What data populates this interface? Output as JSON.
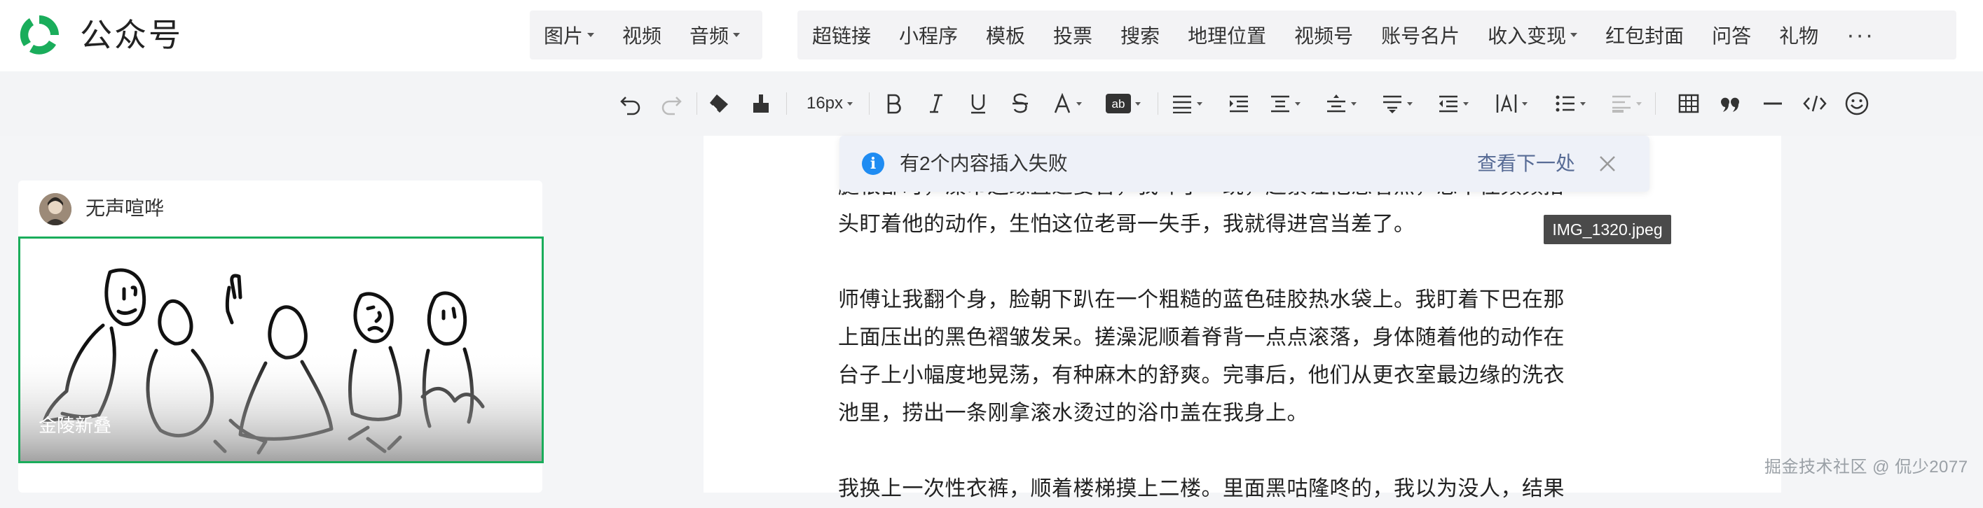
{
  "brand": {
    "name": "公众号"
  },
  "insert_menu": {
    "group1": [
      {
        "label": "图片",
        "dropdown": true
      },
      {
        "label": "视频",
        "dropdown": false
      },
      {
        "label": "音频",
        "dropdown": true
      }
    ],
    "group2": [
      {
        "label": "超链接",
        "dropdown": false
      },
      {
        "label": "小程序",
        "dropdown": false
      },
      {
        "label": "模板",
        "dropdown": false
      },
      {
        "label": "投票",
        "dropdown": false
      },
      {
        "label": "搜索",
        "dropdown": false
      },
      {
        "label": "地理位置",
        "dropdown": false
      },
      {
        "label": "视频号",
        "dropdown": false
      },
      {
        "label": "账号名片",
        "dropdown": false
      },
      {
        "label": "收入变现",
        "dropdown": true
      },
      {
        "label": "红包封面",
        "dropdown": false
      },
      {
        "label": "问答",
        "dropdown": false
      },
      {
        "label": "礼物",
        "dropdown": false
      }
    ],
    "more_label": "···"
  },
  "format_toolbar": {
    "font_size": "16px",
    "icons": [
      "undo-icon",
      "redo-icon",
      "clear-format-icon",
      "format-painter-icon",
      "font-size-select",
      "bold-icon",
      "italic-icon",
      "underline-icon",
      "strikethrough-icon",
      "font-color-icon",
      "background-color-icon",
      "align-icon",
      "indent-icon",
      "paragraph-spacing-icon",
      "line-height-icon",
      "letter-spacing-icon",
      "first-line-indent-icon",
      "text-spacing-icon",
      "list-icon",
      "ruler-icon",
      "table-icon",
      "quote-icon",
      "divider-icon",
      "code-icon",
      "emoji-icon"
    ]
  },
  "article_card": {
    "author": "无声喧哗",
    "cover_title": "金陵新叠"
  },
  "notice": {
    "message": "有2个内容插入失败",
    "action": "查看下一处"
  },
  "image_tag": {
    "label": "IMG_1320.jpeg"
  },
  "editor": {
    "paragraphs": [
      "腿根部时，澡巾边缘直逼要害，我吓了一跳，赶紧让他悠着点，忍不住频频抬",
      "头盯着他的动作，生怕这位老哥一失手，我就得进宫当差了。",
      "师傅让我翻个身，脸朝下趴在一个粗糙的蓝色硅胶热水袋上。我盯着下巴在那",
      "上面压出的黑色褶皱发呆。搓澡泥顺着脊背一点点滚落，身体随着他的动作在",
      "台子上小幅度地晃荡，有种麻木的舒爽。完事后，他们从更衣室最边缘的洗衣",
      "池里，捞出一条刚拿滚水烫过的浴巾盖在我身上。",
      "我换上一次性衣裤，顺着楼梯摸上二楼。里面黑咕隆咚的，我以为没人，结果"
    ]
  },
  "watermark": {
    "text": "掘金技术社区 @ 侃少2077"
  },
  "colors": {
    "accent_green": "#1aad5b",
    "link_blue": "#576b95",
    "info_blue": "#1f8cf2"
  }
}
